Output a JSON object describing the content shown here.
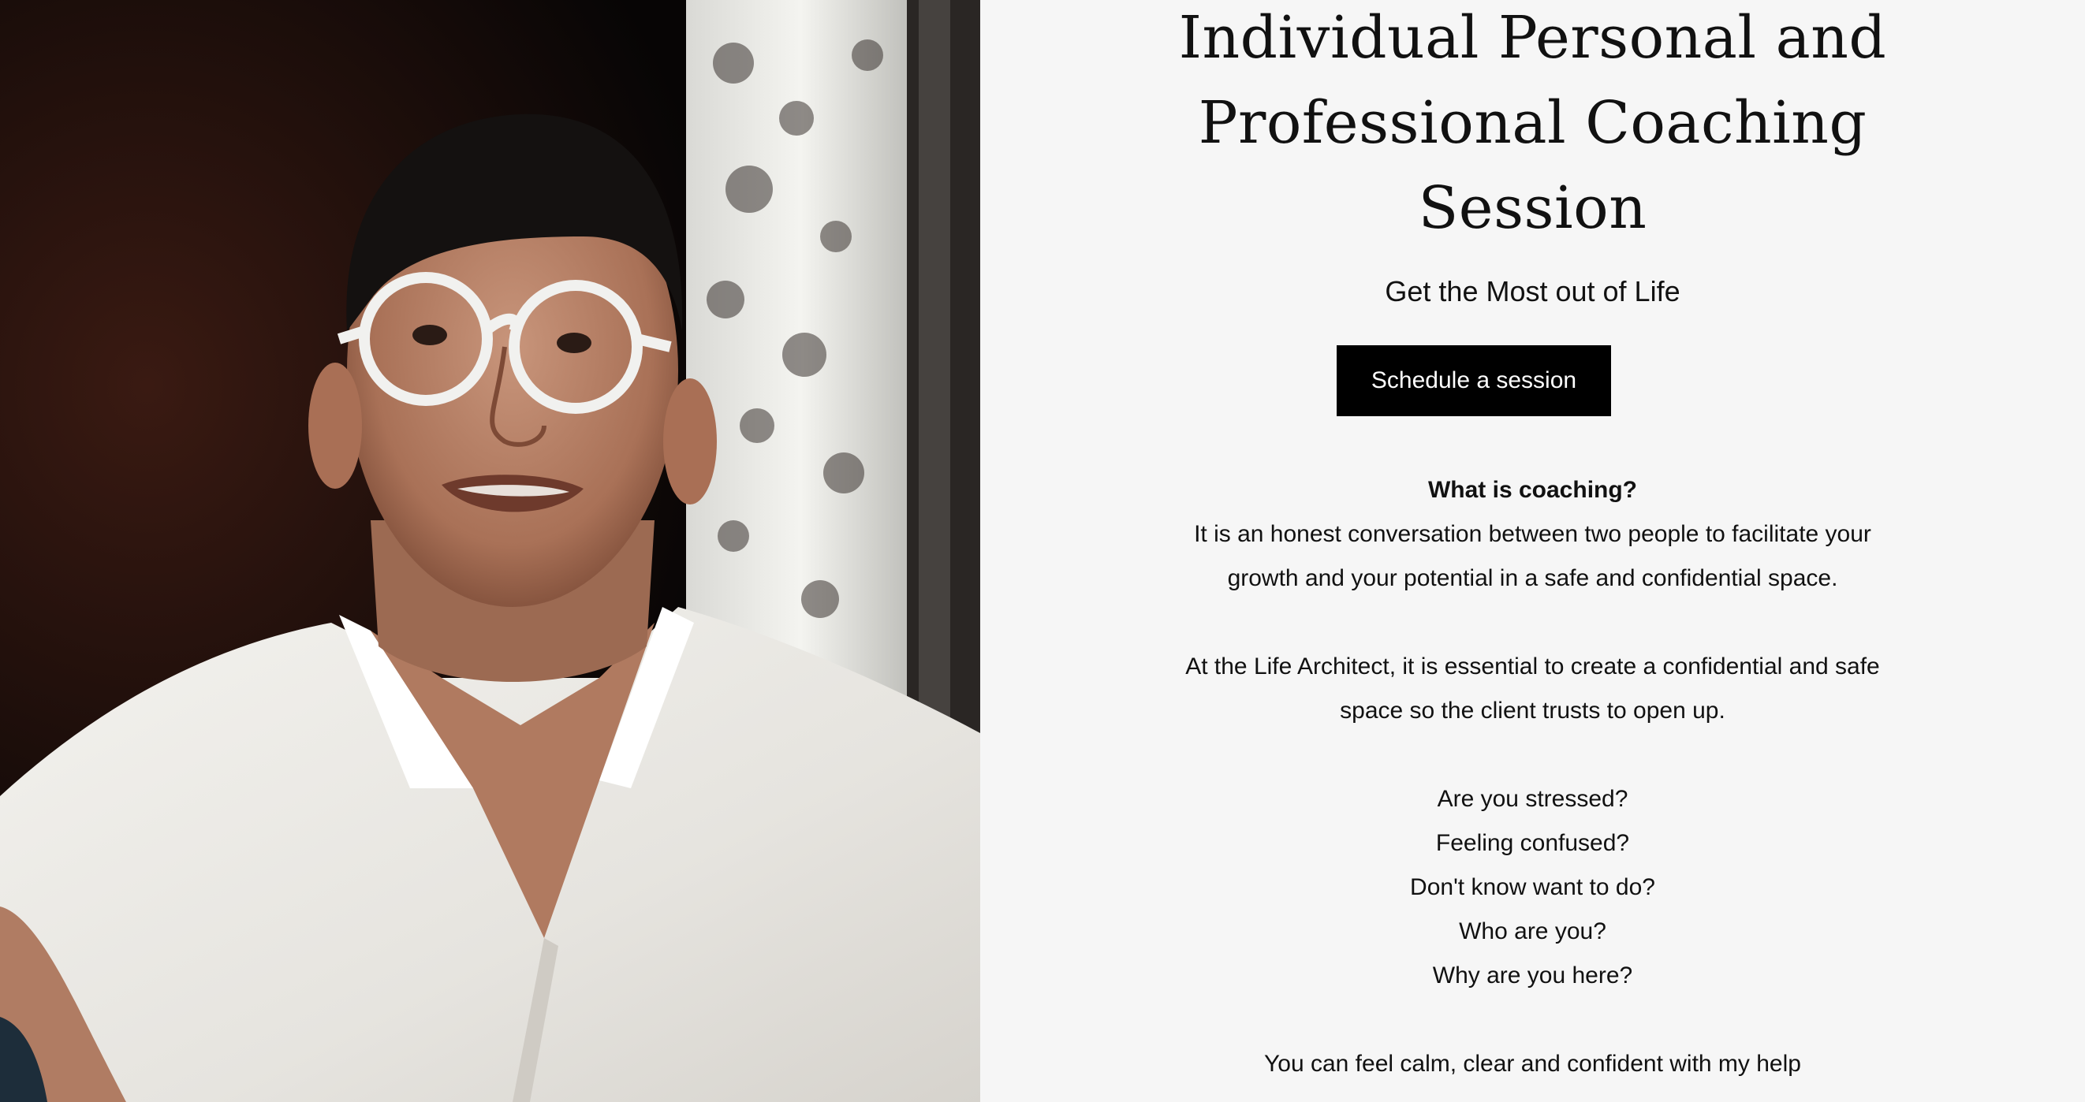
{
  "hero": {
    "title_line1": "Individual Personal and",
    "title_line2": "Professional Coaching",
    "title_line3": "Session",
    "subtitle": "Get the Most out of Life",
    "cta_label": "Schedule a session"
  },
  "about": {
    "heading": "What is coaching?",
    "para1_line1": "It is an honest conversation between two people to facilitate your",
    "para1_line2": "growth and your potential in a safe and confidential space.",
    "para2_line1": "At the Life Architect, it is essential to create a confidential and safe",
    "para2_line2": "space so the client trusts to open up.",
    "questions": [
      "Are you stressed?",
      "Feeling confused?",
      "Don't know want to do?",
      "Who are you?",
      "Why are you here?"
    ],
    "closing": "You can feel calm, clear and confident with my help"
  },
  "colors": {
    "background": "#f6f6f6",
    "button_bg": "#000000",
    "button_text": "#ffffff",
    "text": "#111111"
  }
}
